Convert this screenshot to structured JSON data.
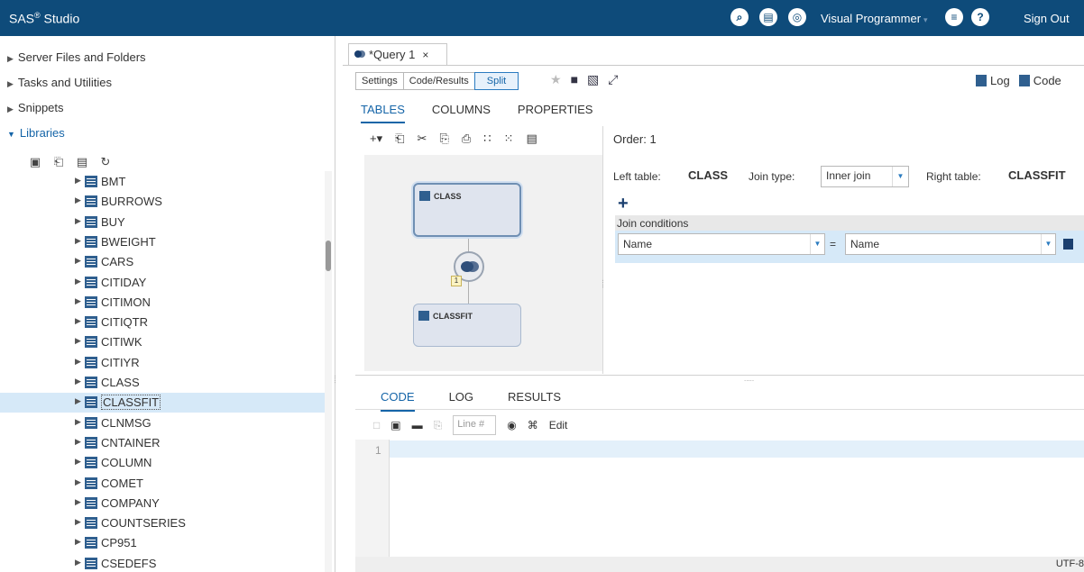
{
  "app": {
    "title": "SAS",
    "title_mark": "®",
    "title_suffix": " Studio"
  },
  "topbar": {
    "mode_label": "Visual Programmer",
    "sign_out": "Sign Out"
  },
  "nav": {
    "server_files": "Server Files and Folders",
    "tasks": "Tasks and Utilities",
    "snippets": "Snippets",
    "libraries": "Libraries"
  },
  "libraries": {
    "items": [
      "BMT",
      "BURROWS",
      "BUY",
      "BWEIGHT",
      "CARS",
      "CITIDAY",
      "CITIMON",
      "CITIQTR",
      "CITIWK",
      "CITIYR",
      "CLASS",
      "CLASSFIT",
      "CLNMSG",
      "CNTAINER",
      "COLUMN",
      "COMET",
      "COMPANY",
      "COUNTSERIES",
      "CP951",
      "CSEDEFS"
    ],
    "selected": "CLASSFIT"
  },
  "query_tab": {
    "label": "*Query 1",
    "close": "×"
  },
  "view_modes": {
    "settings": "Settings",
    "code_results": "Code/Results",
    "split": "Split"
  },
  "log_code": {
    "log": "Log",
    "code": "Code"
  },
  "query_tabs": {
    "tables": "TABLES",
    "columns": "COLUMNS",
    "properties": "PROPERTIES"
  },
  "diagram": {
    "left_node": "CLASS",
    "right_node": "CLASSFIT",
    "join_badge": "1"
  },
  "join_props": {
    "order_label": "Order:",
    "order_value": "1",
    "left_table_label": "Left table:",
    "left_table_value": "CLASS",
    "join_type_label": "Join type:",
    "join_type_value": "Inner join",
    "right_table_label": "Right table:",
    "right_table_value": "CLASSFIT",
    "add": "+",
    "conditions_header": "Join conditions",
    "condition": {
      "left": "Name",
      "operator": "=",
      "right": "Name"
    }
  },
  "code_tabs": {
    "code": "CODE",
    "log": "LOG",
    "results": "RESULTS"
  },
  "code_tools": {
    "line_placeholder": "Line #",
    "edit": "Edit"
  },
  "editor": {
    "line_number": "1",
    "encoding": "UTF-8"
  }
}
